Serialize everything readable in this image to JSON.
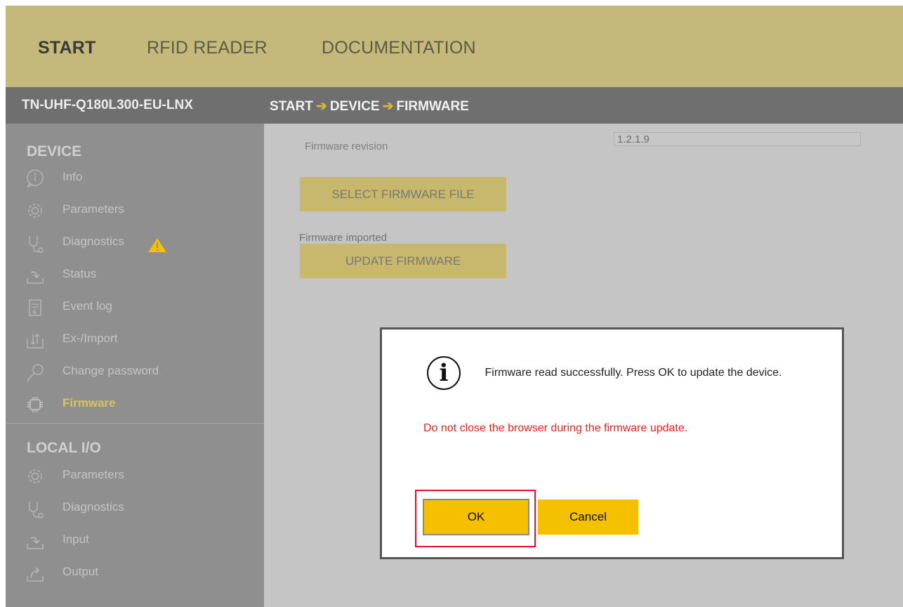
{
  "topnav": {
    "tabs": [
      "START",
      "RFID READER",
      "DOCUMENTATION"
    ]
  },
  "header": {
    "device_name": "TN-UHF-Q180L300-EU-LNX",
    "breadcrumb": [
      "START",
      "DEVICE",
      "FIRMWARE"
    ],
    "breadcrumb_separator": "➔"
  },
  "sidebar": {
    "device_title": "DEVICE",
    "device_items": [
      {
        "label": "Info",
        "icon": "info-icon"
      },
      {
        "label": "Parameters",
        "icon": "gear-icon"
      },
      {
        "label": "Diagnostics",
        "icon": "stethoscope-icon"
      },
      {
        "label": "Status",
        "icon": "status-arrow-icon"
      },
      {
        "label": "Event log",
        "icon": "event-log-icon"
      },
      {
        "label": "Ex-/Import",
        "icon": "import-export-icon"
      },
      {
        "label": "Change password",
        "icon": "key-icon"
      },
      {
        "label": "Firmware",
        "icon": "chip-icon"
      }
    ],
    "local_title": "LOCAL I/O",
    "local_items": [
      {
        "label": "Parameters",
        "icon": "gear-icon"
      },
      {
        "label": "Diagnostics",
        "icon": "stethoscope-icon"
      },
      {
        "label": "Input",
        "icon": "input-arrow-icon"
      },
      {
        "label": "Output",
        "icon": "output-arrow-icon"
      }
    ]
  },
  "main": {
    "firmware_revision_label": "Firmware revision",
    "firmware_revision_value": "1.2.1.9",
    "select_button": "SELECT FIRMWARE FILE",
    "imported_label": "Firmware imported",
    "update_button": "UPDATE FIRMWARE"
  },
  "dialog": {
    "message": "Firmware read successfully. Press OK to update the device.",
    "warning": "Do not close the browser during the firmware update.",
    "ok_label": "OK",
    "cancel_label": "Cancel"
  },
  "colors": {
    "topnav_bg": "#c4b87b",
    "header_bg": "#6f6f6f",
    "sidebar_bg": "#8f8f8f",
    "accent_yellow": "#f5c000",
    "warning_red": "#e8231a"
  }
}
